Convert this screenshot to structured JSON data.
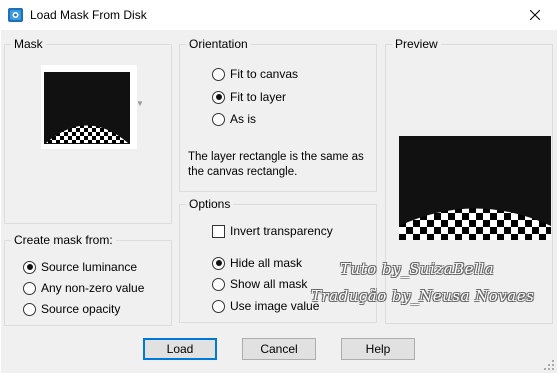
{
  "window": {
    "title": "Load Mask From Disk",
    "icon": "app-icon",
    "close_icon": "close-icon"
  },
  "mask": {
    "group_title": "Mask"
  },
  "create_from": {
    "group_title": "Create mask from:",
    "options": [
      {
        "label": "Source luminance",
        "selected": true
      },
      {
        "label": "Any non-zero value",
        "selected": false
      },
      {
        "label": "Source opacity",
        "selected": false
      }
    ]
  },
  "orientation": {
    "group_title": "Orientation",
    "options": [
      {
        "label": "Fit to canvas",
        "selected": false
      },
      {
        "label": "Fit to layer",
        "selected": true
      },
      {
        "label": "As is",
        "selected": false
      }
    ],
    "description_line1": "The layer rectangle is the same as",
    "description_line2": "the canvas rectangle."
  },
  "options": {
    "group_title": "Options",
    "invert_label": "Invert transparency",
    "invert_checked": false,
    "choices": [
      {
        "label": "Hide all mask",
        "selected": true
      },
      {
        "label": "Show all mask",
        "selected": false
      },
      {
        "label": "Use image value",
        "selected": false
      }
    ]
  },
  "preview": {
    "group_title": "Preview"
  },
  "watermark": {
    "line1": "Tuto by_SuizaBella",
    "line2": "Tradução by_Neusa Novaes"
  },
  "buttons": {
    "load": "Load",
    "cancel": "Cancel",
    "help": "Help"
  },
  "colors": {
    "default_button_border": "#0078d7",
    "dialog_bg": "#f0f0f0",
    "preview_bg": "#111111"
  }
}
